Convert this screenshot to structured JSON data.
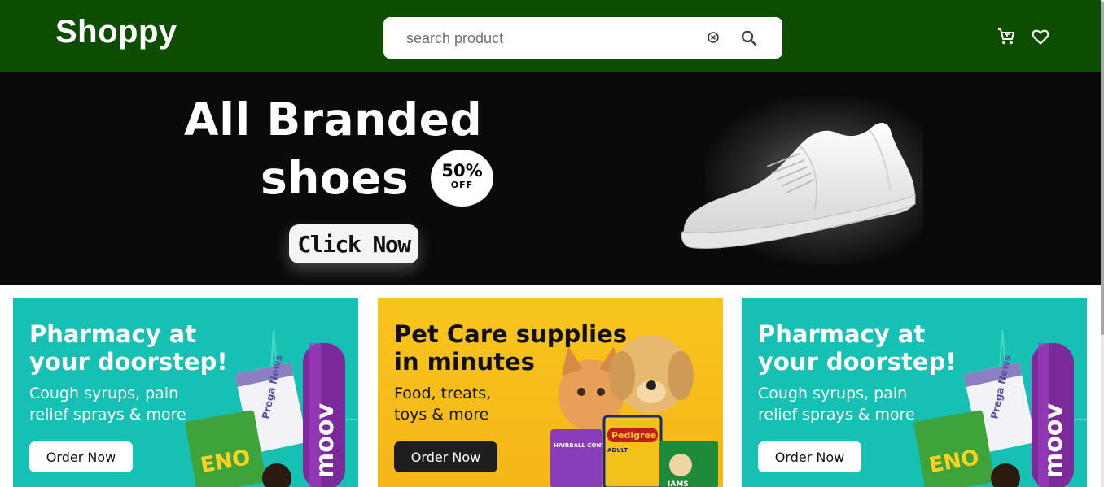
{
  "header": {
    "logo": "Shoppy",
    "search_placeholder": "search product",
    "icons": [
      "clear-icon",
      "search-icon",
      "cart-icon",
      "heart-icon"
    ]
  },
  "hero": {
    "line1": "All Branded",
    "line2": "shoes",
    "discount_value": "50%",
    "discount_label": "OFF",
    "cta": "Click Now"
  },
  "promos": [
    {
      "title": "Pharmacy at\nyour doorstep!",
      "subtitle": "Cough syrups, pain\nrelief sprays & more",
      "button": "Order Now",
      "products": [
        "Prega News",
        "ENO",
        "moov"
      ]
    },
    {
      "title": "Pet Care supplies\nin minutes",
      "subtitle": "Food, treats,\ntoys & more",
      "button": "Order Now",
      "products": [
        "HAIRBALL CONTROL",
        "Pedigree",
        "ADULT",
        "IAMS"
      ]
    },
    {
      "title": "Pharmacy at\nyour doorstep!",
      "subtitle": "Cough syrups, pain\nrelief sprays & more",
      "button": "Order Now",
      "products": [
        "Prega News",
        "ENO",
        "moov"
      ]
    }
  ],
  "colors": {
    "header_bg": "#0d4d00",
    "teal": "#16c0b2",
    "yellow": "#f7c51d",
    "dark_button": "#1e1e1e"
  }
}
